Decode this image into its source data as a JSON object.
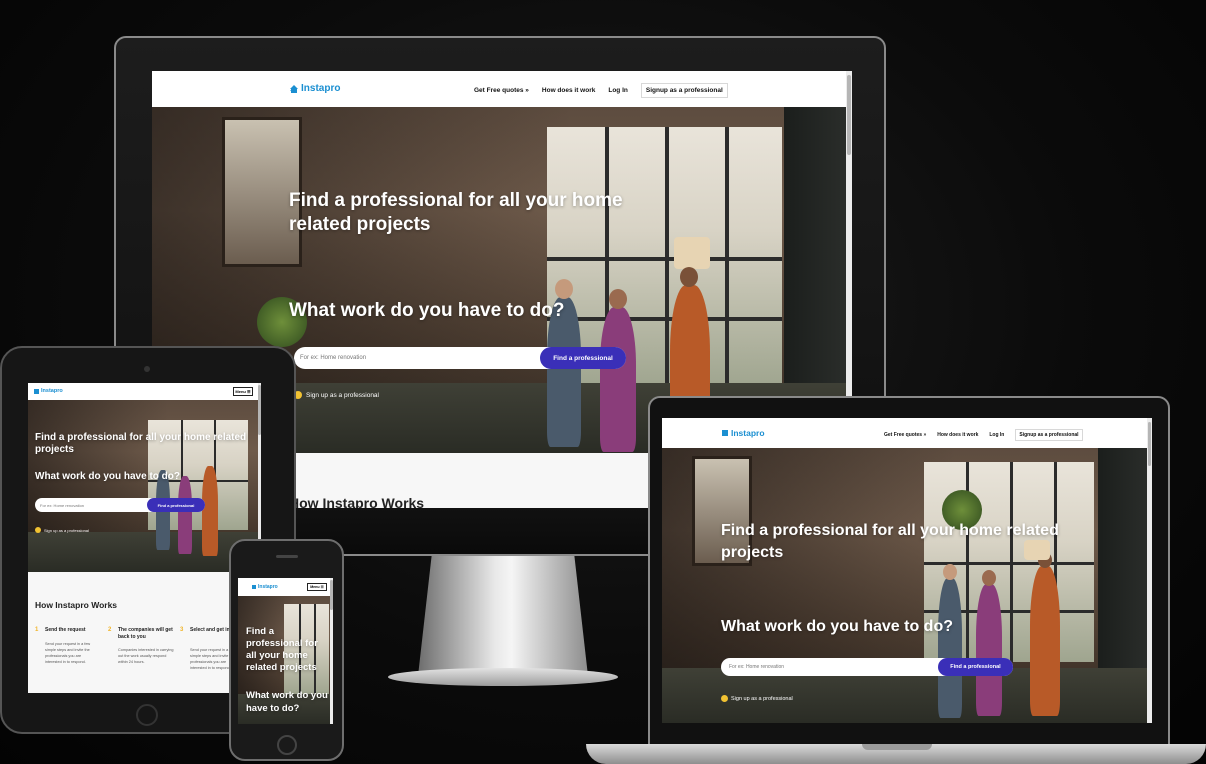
{
  "brand": "Instapro",
  "nav": {
    "free_quotes": "Get Free quotes »",
    "how_it_works": "How does it work",
    "login": "Log In",
    "signup_pro": "Signup as a professional",
    "menu": "Menu ☰"
  },
  "hero": {
    "headline": "Find a professional for all your home related projects",
    "question": "What work do you have to do?",
    "search_placeholder": "For ex: Home renovation",
    "find_button": "Find a professional",
    "signup_link": "Sign up as a professional"
  },
  "how": {
    "title": "How Instapro Works",
    "steps": [
      {
        "num": "1",
        "title": "Send the request",
        "desc": "Send your request in a few simple steps and invite the professionals you are interested in to respond."
      },
      {
        "num": "2",
        "title": "The companies will get back to you",
        "desc": "Companies interested in carrying out the work usually respond within 24 hours."
      },
      {
        "num": "3",
        "title": "Select and get in touch",
        "desc": "Send your request in a few simple steps and invite the professionals you are interested in to respond."
      }
    ]
  },
  "colors": {
    "brand_blue": "#1b8fd1",
    "button_purple": "#3a2fb8",
    "accent_yellow": "#f1c232"
  }
}
